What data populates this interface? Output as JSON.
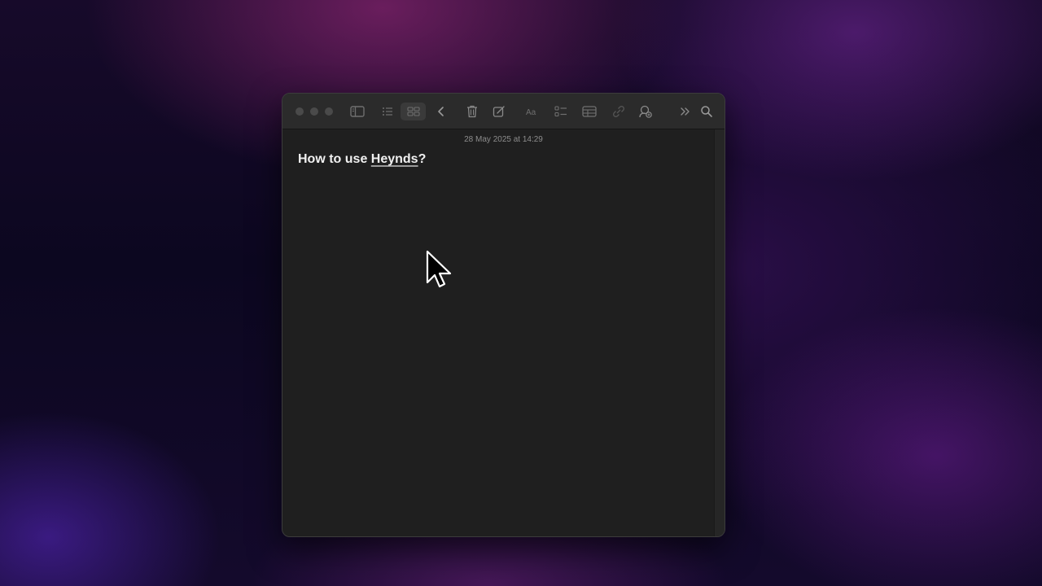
{
  "window": {
    "toolbar": {
      "icons": [
        "sidebar-icon",
        "list-view-icon",
        "gallery-view-icon",
        "back-chevron-icon",
        "trash-icon",
        "compose-icon",
        "text-format-icon",
        "checklist-icon",
        "table-icon",
        "link-icon",
        "share-icon",
        "more-chevrons-icon",
        "search-icon"
      ]
    },
    "note": {
      "date": "28 May 2025 at 14:29",
      "title_prefix": "How to use ",
      "title_misspelled": "Heynds",
      "title_suffix": "?"
    }
  },
  "colors": {
    "window_bg": "#1f1f1f",
    "titlebar_bg": "#2b2b2b",
    "title_text": "#f0f0f0",
    "date_text": "#8d8d8d"
  }
}
